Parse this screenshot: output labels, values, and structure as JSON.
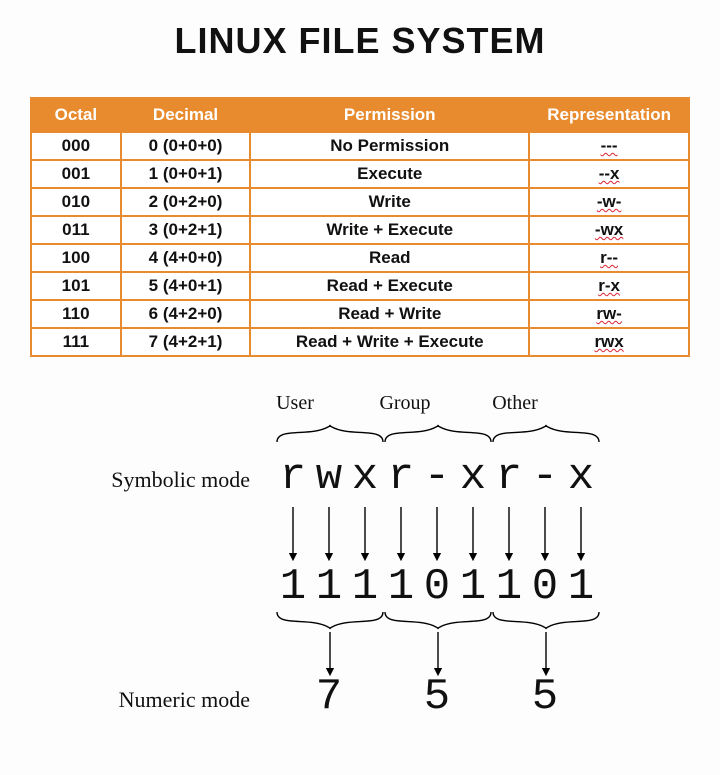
{
  "title": "LINUX FILE SYSTEM",
  "table": {
    "headers": {
      "octal": "Octal",
      "decimal": "Decimal",
      "permission": "Permission",
      "representation": "Representation"
    },
    "rows": [
      {
        "octal": "000",
        "decimal": "0 (0+0+0)",
        "permission": "No Permission",
        "representation": "---"
      },
      {
        "octal": "001",
        "decimal": "1 (0+0+1)",
        "permission": "Execute",
        "representation": "--x"
      },
      {
        "octal": "010",
        "decimal": "2 (0+2+0)",
        "permission": "Write",
        "representation": "-w-"
      },
      {
        "octal": "011",
        "decimal": "3 (0+2+1)",
        "permission": "Write + Execute",
        "representation": "-wx"
      },
      {
        "octal": "100",
        "decimal": "4 (4+0+0)",
        "permission": "Read",
        "representation": "r--"
      },
      {
        "octal": "101",
        "decimal": "5 (4+0+1)",
        "permission": "Read + Execute",
        "representation": "r-x"
      },
      {
        "octal": "110",
        "decimal": "6 (4+2+0)",
        "permission": "Read + Write",
        "representation": "rw-"
      },
      {
        "octal": "111",
        "decimal": "7 (4+2+1)",
        "permission": "Read + Write + Execute",
        "representation": "rwx"
      }
    ]
  },
  "diagram": {
    "group_labels": {
      "user": "User",
      "group": "Group",
      "other": "Other"
    },
    "side_labels": {
      "symbolic": "Symbolic mode",
      "numeric": "Numeric mode"
    },
    "symbolic": [
      "r",
      "w",
      "x",
      "r",
      "-",
      "x",
      "r",
      "-",
      "x"
    ],
    "binary": [
      "1",
      "1",
      "1",
      "1",
      "0",
      "1",
      "1",
      "0",
      "1"
    ],
    "numeric": [
      "7",
      "5",
      "5"
    ]
  }
}
